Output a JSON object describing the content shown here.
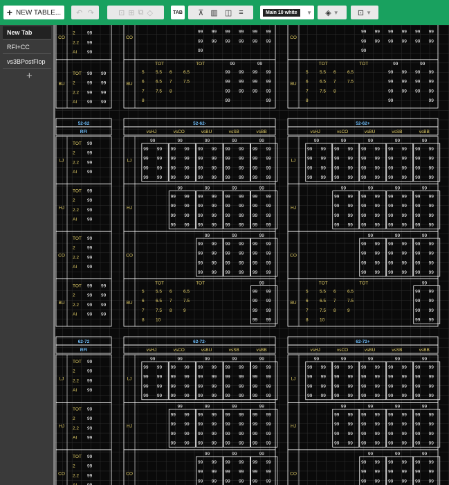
{
  "toolbar": {
    "new_table_label": "NEW TABLE...",
    "undo_icon": "undo-icon",
    "redo_icon": "redo-icon",
    "tab_label": "TAB",
    "font_size_label": "Main 10 white",
    "colors": {
      "bar": "#19a15f"
    }
  },
  "tabs": [
    {
      "label": "New Tab",
      "active": true
    },
    {
      "label": "RFI+CC",
      "active": false
    },
    {
      "label": "vs3BPostFlop",
      "active": false
    }
  ],
  "sheet": {
    "value": "99",
    "row_labels": [
      "TOT",
      "2",
      "2.2",
      "AI"
    ],
    "positions": [
      "LJ",
      "HJ",
      "CO",
      "BU"
    ],
    "vs_labels": [
      "vsHJ",
      "vsCO",
      "vsBU",
      "vsSB",
      "vsBB"
    ],
    "rfi_label": "RFI",
    "sizing_row1": [
      "5",
      "5.5",
      "6",
      "6.5"
    ],
    "sizing_row2": [
      "6",
      "6.5",
      "7",
      "7.5"
    ],
    "sizing_row3": [
      "7",
      "7.5",
      "8",
      "9"
    ],
    "sizing_row4": [
      "8",
      "10"
    ],
    "sections": [
      {
        "ranges": [
          "",
          "",
          ""
        ],
        "top": true
      },
      {
        "ranges": [
          "52-62",
          "52-62-",
          "52-62+"
        ]
      },
      {
        "ranges": [
          "62-72",
          "62-72-",
          "62-72+"
        ]
      }
    ],
    "colors": {
      "bg": "#000000",
      "text": "#ffffff",
      "header": "#6fc0ff",
      "label": "#e8d36a",
      "grid": "#2f2f2f",
      "border": "#ffffff"
    }
  }
}
